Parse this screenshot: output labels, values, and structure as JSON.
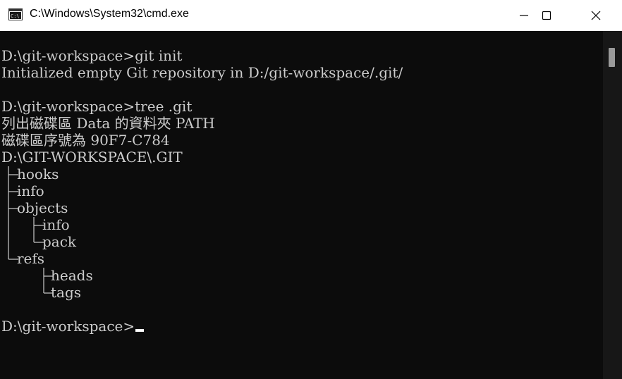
{
  "window": {
    "title": "C:\\Windows\\System32\\cmd.exe",
    "icon": "cmd-icon",
    "colors": {
      "titlebar": "#ffffff",
      "console_bg": "#0c0c0c",
      "console_fg": "#cccccc",
      "scrollbar": "#171717"
    }
  },
  "console": {
    "lines": [
      "",
      "D:\\git-workspace>git init",
      "Initialized empty Git repository in D:/git-workspace/.git/",
      "",
      "D:\\git-workspace>tree .git",
      "列出磁碟區 Data 的資料夾 PATH",
      "磁碟區序號為 90F7-C784",
      "D:\\GIT-WORKSPACE\\.GIT",
      "hooks",
      "info",
      "objects",
      "info",
      "pack",
      "refs",
      "heads",
      "tags",
      "",
      "D:\\git-workspace>"
    ]
  }
}
